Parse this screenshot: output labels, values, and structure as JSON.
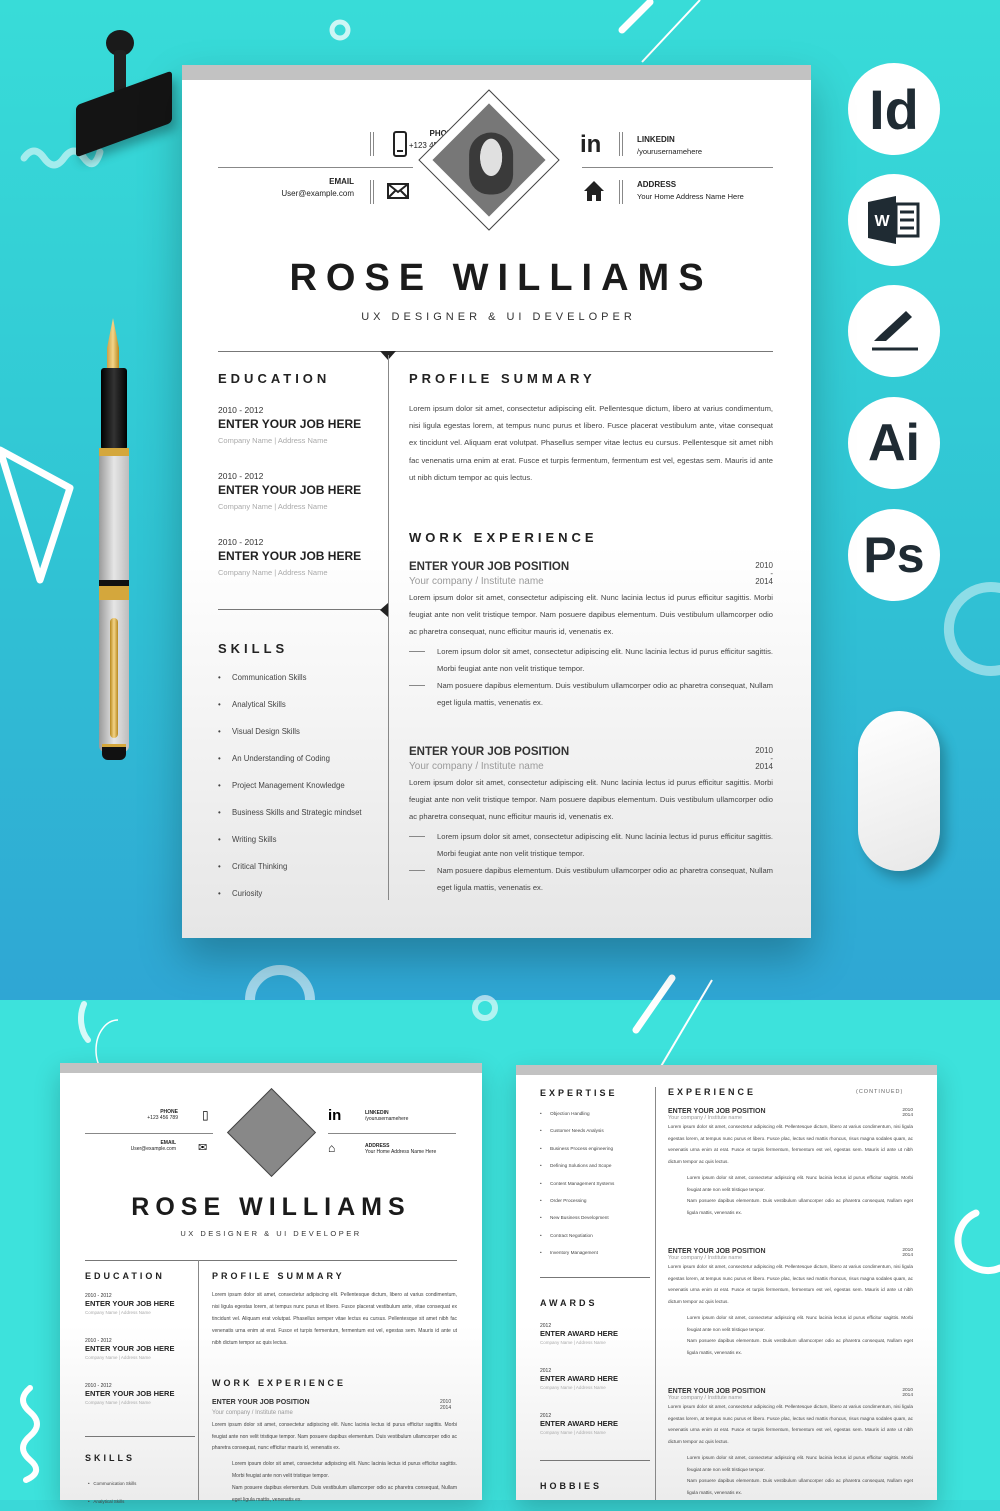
{
  "resume": {
    "name": "ROSE WILLIAMS",
    "title": "UX DESIGNER & UI DEVELOPER",
    "contact": {
      "phone_label": "PHONE",
      "phone": "+123 456 789",
      "email_label": "EMAIL",
      "email": "User@example.com",
      "linkedin_label": "LINKEDIN",
      "linkedin": "/yourusernamehere",
      "address_label": "ADDRESS",
      "address": "Your Home Address Name Here"
    },
    "education": {
      "heading": "EDUCATION",
      "items": [
        {
          "years": "2010 - 2012",
          "title": "ENTER YOUR JOB HERE",
          "sub": "Company Name |  Address Name"
        },
        {
          "years": "2010 - 2012",
          "title": "ENTER YOUR JOB HERE",
          "sub": "Company Name |  Address Name"
        },
        {
          "years": "2010 - 2012",
          "title": "ENTER YOUR JOB HERE",
          "sub": "Company Name |  Address Name"
        }
      ]
    },
    "skills": {
      "heading": "SKILLS",
      "items": [
        "Communication Skills",
        "Analytical Skills",
        "Visual Design Skills",
        "An Understanding of Coding",
        "Project Management Knowledge",
        "Business Skills and Strategic mindset",
        "Writing Skills",
        "Critical Thinking",
        "Curiosity"
      ]
    },
    "profile": {
      "heading": "PROFILE SUMMARY",
      "text": "Lorem ipsum dolor sit amet, consectetur adipiscing elit. Pellentesque dictum, libero at varius condimentum, nisi ligula egestas lorem, at tempus nunc purus et libero. Fusce placerat vestibulum ante, vitae consequat ex tincidunt vel. Aliquam erat volutpat. Phasellus semper vitae lectus eu cursus. Pellentesque sit amet nibh fac venenatis urna enim at erat. Fusce et turpis fermentum, fermentum est vel, egestas sem. Mauris id ante ut nibh dictum tempor ac quis lectus."
    },
    "work": {
      "heading": "WORK EXPERIENCE",
      "jobs": [
        {
          "position": "ENTER YOUR JOB POSITION",
          "company": "Your company / Institute name",
          "start": "2010",
          "dash": "-",
          "end": "2014",
          "text": "Lorem ipsum dolor sit amet, consectetur adipiscing elit. Nunc lacinia lectus id purus efficitur sagittis. Morbi feugiat ante non velit tristique tempor. Nam posuere dapibus elementum. Duis vestibulum ullamcorper odio ac pharetra consequat, nunc efficitur mauris id, venenatis ex.",
          "bullets": [
            "Lorem ipsum dolor sit amet, consectetur adipiscing elit. Nunc lacinia lectus id purus efficitur sagittis. Morbi feugiat ante non velit tristique tempor.",
            "Nam posuere dapibus elementum. Duis vestibulum ullamcorper odio ac pharetra consequat, Nullam eget ligula mattis, venenatis ex."
          ]
        },
        {
          "position": "ENTER YOUR JOB POSITION",
          "company": "Your company / Institute name",
          "start": "2010",
          "dash": "-",
          "end": "2014",
          "text": "Lorem ipsum dolor sit amet, consectetur adipiscing elit. Nunc lacinia lectus id purus efficitur sagittis. Morbi feugiat ante non velit tristique tempor. Nam posuere dapibus elementum. Duis vestibulum ullamcorper odio ac pharetra consequat, nunc efficitur mauris id, venenatis ex.",
          "bullets": [
            "Lorem ipsum dolor sit amet, consectetur adipiscing elit. Nunc lacinia lectus id purus efficitur sagittis. Morbi feugiat ante non velit tristique tempor.",
            "Nam posuere dapibus elementum. Duis vestibulum ullamcorper odio ac pharetra consequat, Nullam eget ligula mattis, venenatis ex."
          ]
        }
      ]
    }
  },
  "page2": {
    "expertise": {
      "heading": "EXPERTISE",
      "items": [
        "Objection Handling",
        "Customer Needs Analysis",
        "Business Process engineering",
        "Defining Solutions and Scope",
        "Content Management Systems",
        "Order Processing",
        "New Business Development",
        "Contract Negotiation",
        "Inventory Management"
      ]
    },
    "awards": {
      "heading": "AWARDS",
      "items": [
        {
          "year": "2012",
          "title": "ENTER AWARD HERE",
          "sub": "Company Name |  Address Name"
        },
        {
          "year": "2012",
          "title": "ENTER AWARD HERE",
          "sub": "Company Name |  Address Name"
        },
        {
          "year": "2012",
          "title": "ENTER AWARD HERE",
          "sub": "Company Name |  Address Name"
        }
      ]
    },
    "hobbies": {
      "heading": "HOBBIES"
    },
    "experience": {
      "heading": "EXPERIENCE",
      "continued": "(CONTINUED)",
      "jobs": [
        {
          "position": "ENTER YOUR JOB POSITION",
          "company": "Your company / Institute name",
          "start": "2010",
          "end": "2014"
        },
        {
          "position": "ENTER YOUR JOB POSITION",
          "company": "Your company / Institute name",
          "start": "2010",
          "end": "2014"
        },
        {
          "position": "ENTER YOUR JOB POSITION",
          "company": "Your company / Institute name",
          "start": "2010",
          "end": "2014"
        }
      ],
      "text": "Lorem ipsum dolor sit amet, consectetur adipiscing elit. Pellentesque dictum, libero at varius condimentum, nisi ligula egestas lorem, at tempus nunc purus et libero. Fusce plac, lectus sed mattis rhoncus, risus magna sodales quam, ac venenatis urna enim at erat. Fusce et turpis fermentum, fermentum est vel, egestas sem. Mauris id ante ut nibh dictum tempor ac quis lectus.",
      "bullets": [
        "Lorem ipsum dolor sit amet, consectetur adipiscing elit. Nunc lacinia lectus id purus efficitur sagittis. Morbi feugiat ante non velit tristique tempor.",
        "Nam posuere dapibus elementum. Duis vestibulum ullamcorper odio ac pharetra consequat, Nullam eget ligula mattis, venenatis ex."
      ]
    }
  },
  "software_badges": [
    "Id",
    "W",
    "pen",
    "Ai",
    "Ps"
  ],
  "colors": {
    "bg_teal": "#3ad8d8",
    "bg_blue": "#2fa6d4",
    "ink": "#222222",
    "topbar": "#c2c2c2"
  }
}
